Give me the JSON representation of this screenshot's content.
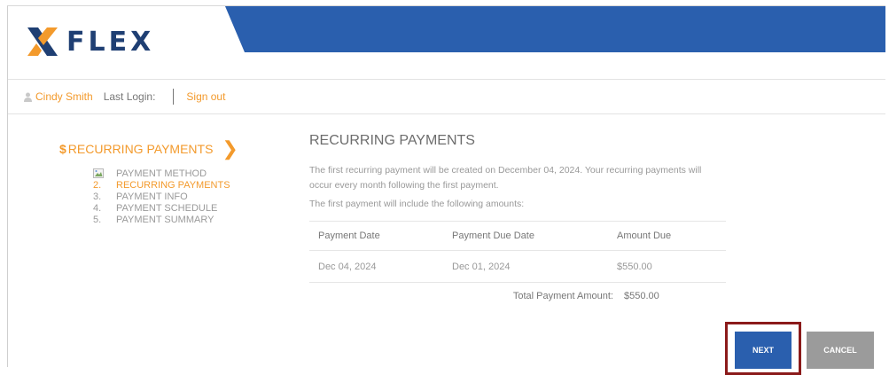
{
  "brand": {
    "name": "FLEX",
    "primary_color": "#2a5fae",
    "accent_color": "#f39a2c"
  },
  "userbar": {
    "user_name": "Cindy Smith",
    "last_login_label": "Last Login:",
    "signout_label": "Sign out"
  },
  "sidebar": {
    "title_prefix": "$",
    "title": "RECURRING PAYMENTS",
    "chevron": "❯",
    "steps": [
      {
        "num": "",
        "label": "PAYMENT METHOD",
        "icon": "broken-image-icon"
      },
      {
        "num": "2.",
        "label": "RECURRING PAYMENTS",
        "active": true
      },
      {
        "num": "3.",
        "label": "PAYMENT INFO"
      },
      {
        "num": "4.",
        "label": "PAYMENT SCHEDULE"
      },
      {
        "num": "5.",
        "label": "PAYMENT SUMMARY"
      }
    ]
  },
  "main": {
    "heading": "RECURRING PAYMENTS",
    "paragraph1": "The first recurring payment will be created on December 04, 2024. Your recurring payments will occur every month following the first payment.",
    "paragraph2": "The first payment will include the following amounts:",
    "table": {
      "headers": [
        "Payment Date",
        "Payment Due Date",
        "Amount Due"
      ],
      "rows": [
        [
          "Dec 04, 2024",
          "Dec 01, 2024",
          "$550.00"
        ]
      ]
    },
    "total_label": "Total Payment Amount:",
    "total_value": "$550.00"
  },
  "actions": {
    "next_label": "NEXT",
    "cancel_label": "CANCEL"
  }
}
